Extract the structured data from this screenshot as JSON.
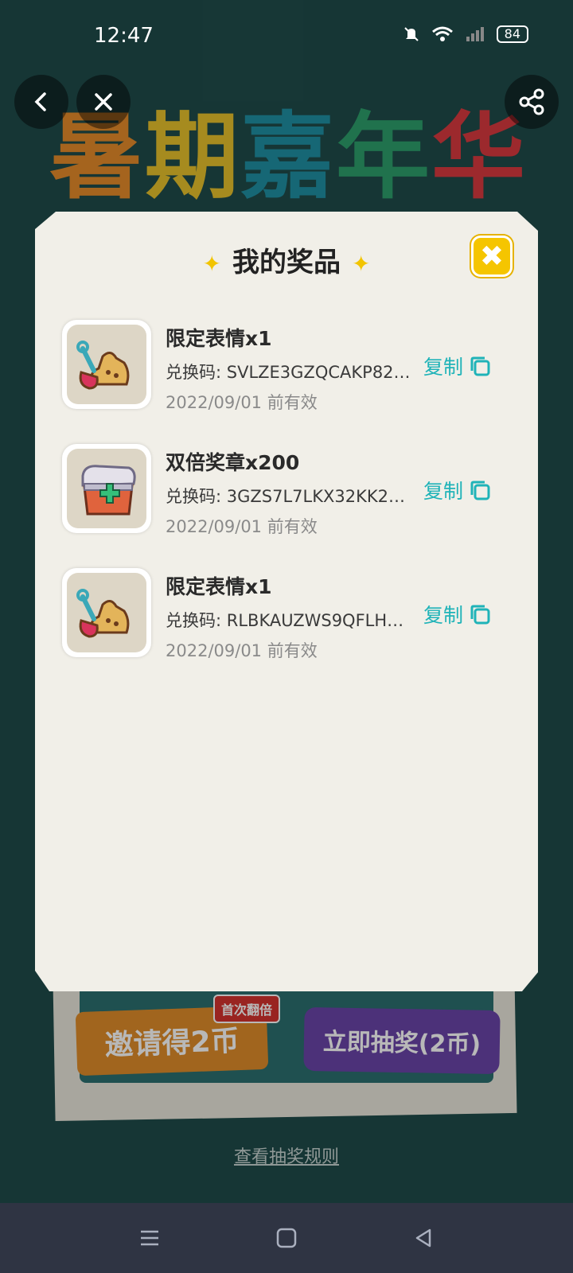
{
  "status_bar": {
    "time": "12:47",
    "battery": "84"
  },
  "banner": {
    "chars": [
      "暑",
      "期",
      "嘉",
      "年",
      "华"
    ],
    "colors": [
      "#e58b2a",
      "#e6c12c",
      "#1f8fa3",
      "#2d9e6b",
      "#d93a3f"
    ]
  },
  "modal": {
    "title": "我的奖品",
    "prizes": [
      {
        "name": "限定表情x1",
        "code": "兑换码: SVLZE3GZQCAKP82…",
        "valid": "2022/09/01 前有效",
        "copy_label": "复制",
        "icon": "sandcastle-shovel-icon"
      },
      {
        "name": "双倍奖章x200",
        "code": "兑换码: 3GZS7L7LKX32KK2…",
        "valid": "2022/09/01 前有效",
        "copy_label": "复制",
        "icon": "treasure-chest-icon"
      },
      {
        "name": "限定表情x1",
        "code": "兑换码: RLBKAUZWS9QFLH…",
        "valid": "2022/09/01 前有效",
        "copy_label": "复制",
        "icon": "sandcastle-shovel-icon"
      }
    ]
  },
  "background": {
    "invite_button": "邀请得2币",
    "first_double_badge": "首次翻倍",
    "draw_button": "立即抽奖(2币)",
    "rules_link": "查看抽奖规则"
  },
  "colors": {
    "accent": "#1fb3b8",
    "close_yellow": "#f5c500"
  }
}
